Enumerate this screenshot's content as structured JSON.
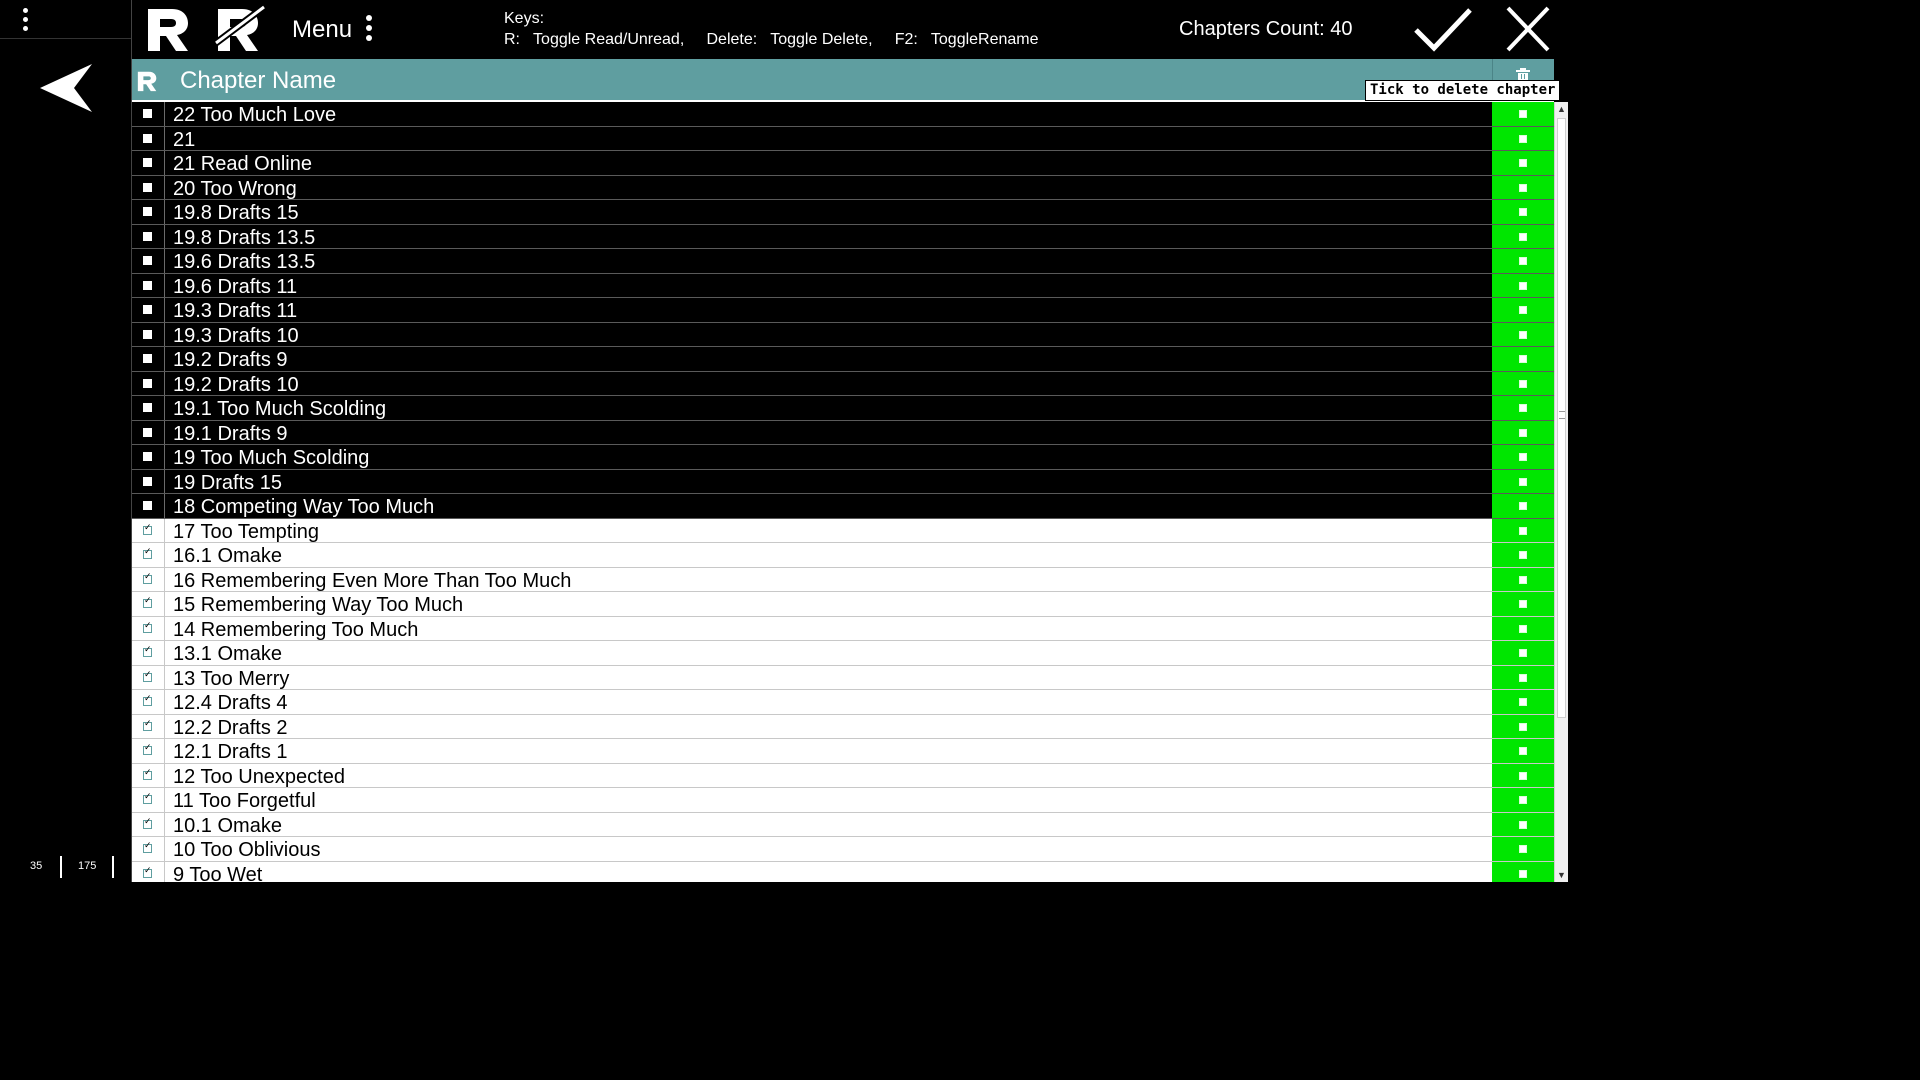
{
  "sidebar": {
    "menu_icon": "vertical-dots-icon",
    "back_icon": "back-arrow-icon",
    "page_current": "35",
    "page_total": "175"
  },
  "toolbar": {
    "logo_icon": "r-logo-icon",
    "logo_struck_icon": "r-logo-struck-icon",
    "menu_label": "Menu",
    "keys_title": "Keys:",
    "keys_line": "R:   Toggle Read/Unread,     Delete:   Toggle Delete,     F2:   ToggleRename",
    "chapters_count": "Chapters Count: 40",
    "ok_icon": "checkmark-icon",
    "cancel_icon": "close-icon"
  },
  "table": {
    "header_read_icon": "r-logo-icon",
    "header_title": "Chapter Name",
    "delete_column_icon": "trash-icon",
    "delete_tooltip": "Tick to delete chapter",
    "rows": [
      {
        "name": "22 Too Much Love",
        "read": false
      },
      {
        "name": "21",
        "read": false
      },
      {
        "name": "21 Read Online",
        "read": false
      },
      {
        "name": "20 Too Wrong",
        "read": false
      },
      {
        "name": "19.8 Drafts 15",
        "read": false
      },
      {
        "name": "19.8 Drafts 13.5",
        "read": false
      },
      {
        "name": "19.6 Drafts 13.5",
        "read": false
      },
      {
        "name": "19.6 Drafts 11",
        "read": false
      },
      {
        "name": "19.3 Drafts 11",
        "read": false
      },
      {
        "name": "19.3 Drafts 10",
        "read": false
      },
      {
        "name": "19.2 Drafts 9",
        "read": false
      },
      {
        "name": "19.2 Drafts 10",
        "read": false
      },
      {
        "name": "19.1 Too Much Scolding",
        "read": false
      },
      {
        "name": "19.1 Drafts 9",
        "read": false
      },
      {
        "name": "19 Too Much Scolding",
        "read": false
      },
      {
        "name": "19 Drafts 15",
        "read": false
      },
      {
        "name": "18 Competing Way Too Much",
        "read": false
      },
      {
        "name": "17 Too Tempting",
        "read": true
      },
      {
        "name": "16.1 Omake",
        "read": true
      },
      {
        "name": "16 Remembering Even More Than Too Much",
        "read": true
      },
      {
        "name": "15 Remembering Way Too Much",
        "read": true
      },
      {
        "name": "14 Remembering Too Much",
        "read": true
      },
      {
        "name": "13.1 Omake",
        "read": true
      },
      {
        "name": "13 Too Merry",
        "read": true
      },
      {
        "name": "12.4 Drafts 4",
        "read": true
      },
      {
        "name": "12.2 Drafts 2",
        "read": true
      },
      {
        "name": "12.1 Drafts 1",
        "read": true
      },
      {
        "name": "12 Too Unexpected",
        "read": true
      },
      {
        "name": "11 Too Forgetful",
        "read": true
      },
      {
        "name": "10.1 Omake",
        "read": true
      },
      {
        "name": "10 Too Oblivious",
        "read": true
      },
      {
        "name": "9 Too Wet",
        "read": true
      }
    ]
  },
  "colors": {
    "header_bg": "#5f9ea0",
    "delete_column_bg": "#00e600",
    "unread_row_bg": "#000000",
    "read_row_bg": "#ffffff"
  }
}
